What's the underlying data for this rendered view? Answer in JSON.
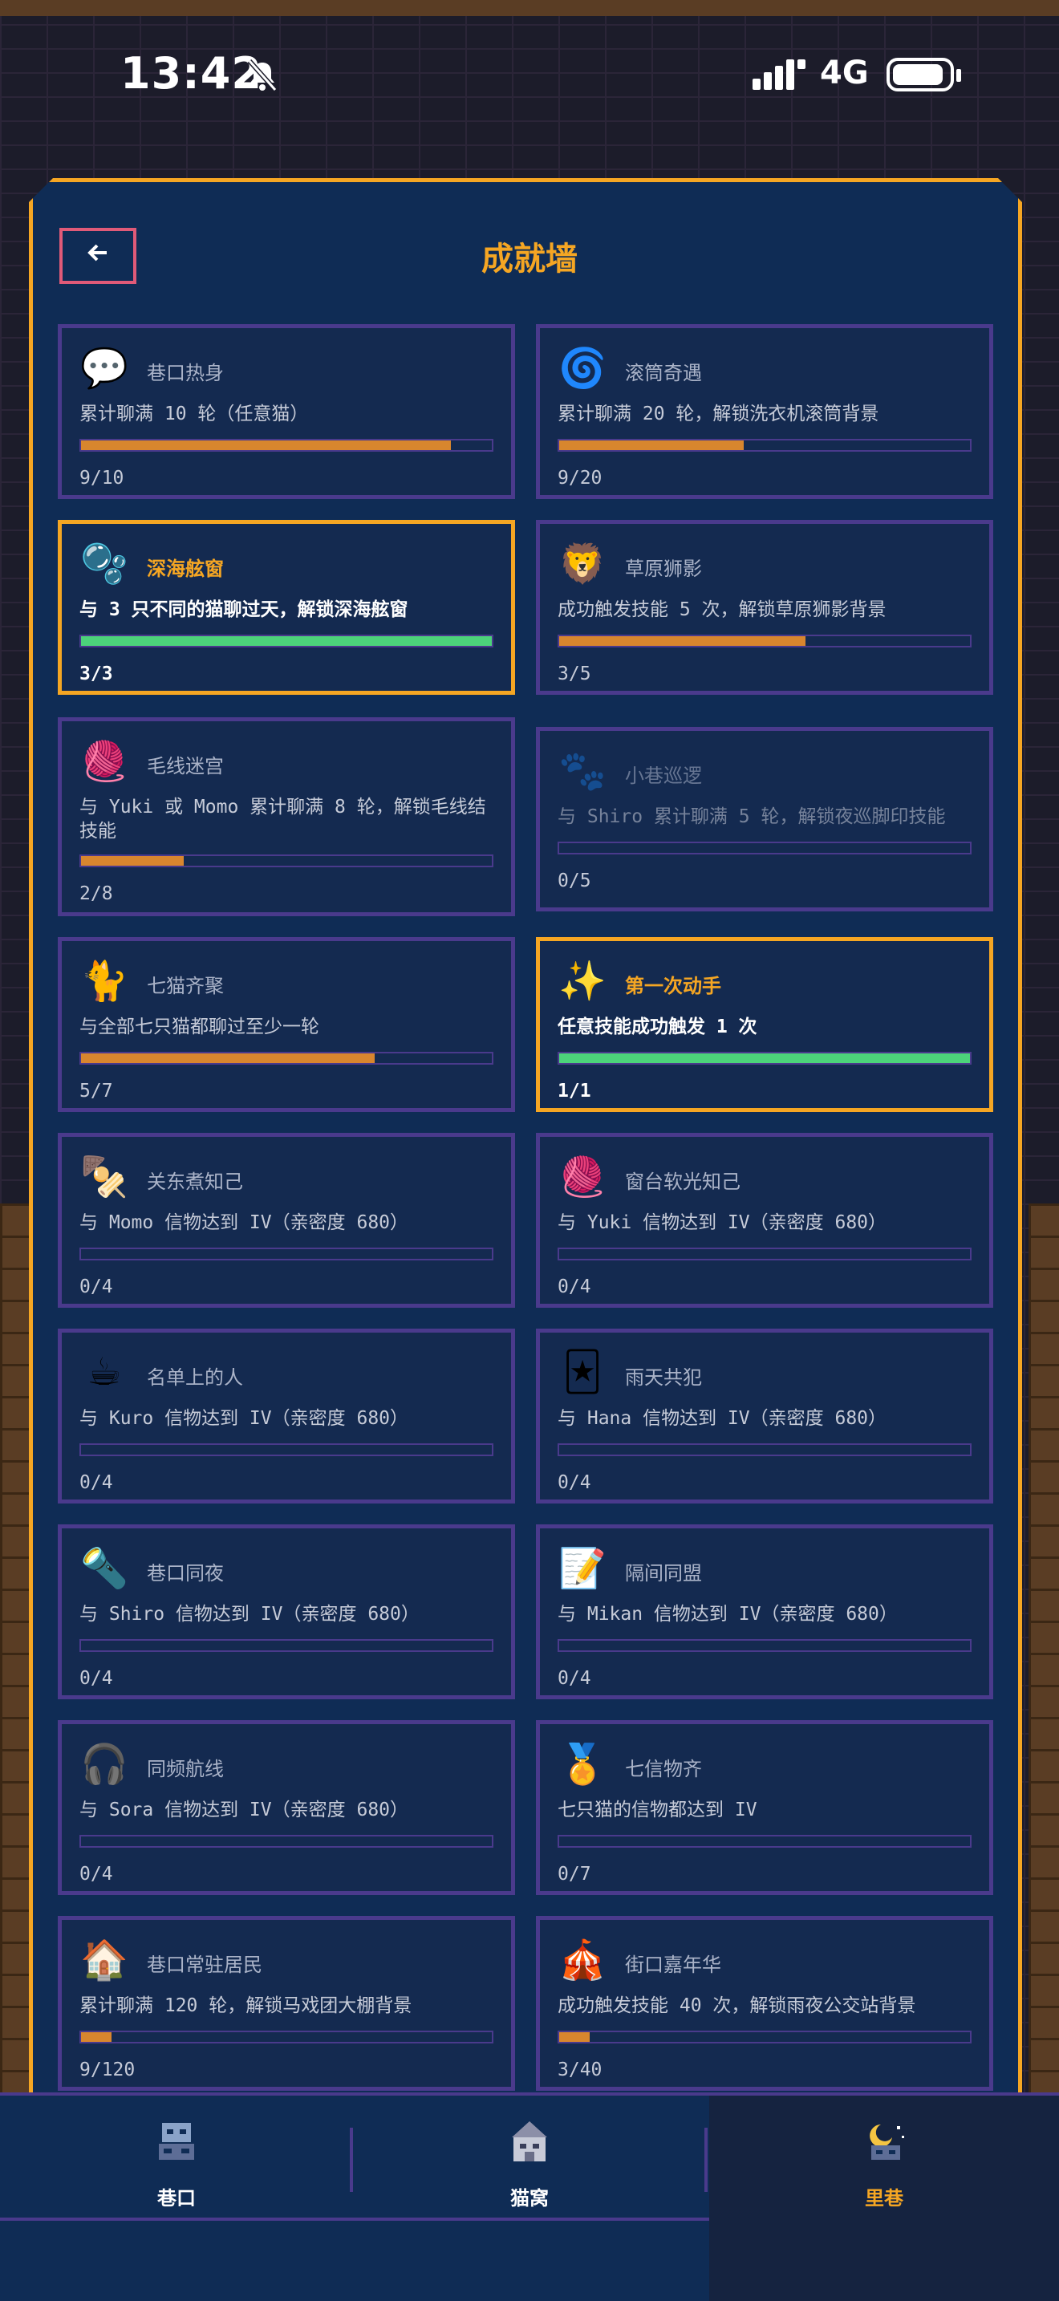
{
  "status": {
    "time": "13:42",
    "network": "4G"
  },
  "header": {
    "title": "成就墙"
  },
  "achievements": [
    {
      "icon": "💬",
      "name": "巷口热身",
      "desc": "累计聊满 10 轮（任意猫）",
      "progress_text": "9/10",
      "progress": 0.9,
      "state": "progress"
    },
    {
      "icon": "🌀",
      "name": "滚筒奇遇",
      "desc": "累计聊满 20 轮，解锁洗衣机滚筒背景",
      "progress_text": "9/20",
      "progress": 0.45,
      "state": "progress"
    },
    {
      "icon": "🫧",
      "name": "深海舷窗",
      "desc": "与 3 只不同的猫聊过天，解锁深海舷窗",
      "progress_text": "3/3",
      "progress": 1.0,
      "state": "done"
    },
    {
      "icon": "🦁",
      "name": "草原狮影",
      "desc": "成功触发技能 5 次，解锁草原狮影背景",
      "progress_text": "3/5",
      "progress": 0.6,
      "state": "progress"
    },
    {
      "icon": "🧶",
      "name": "毛线迷宫",
      "desc": "与 Yuki 或 Momo 累计聊满 8 轮，解锁毛线结技能",
      "progress_text": "2/8",
      "progress": 0.25,
      "state": "progress"
    },
    {
      "icon": "🐾",
      "name": "小巷巡逻",
      "desc": "与 Shiro 累计聊满 5 轮，解锁夜巡脚印技能",
      "progress_text": "0/5",
      "progress": 0.0,
      "state": "locked"
    },
    {
      "icon": "🐈",
      "name": "七猫齐聚",
      "desc": "与全部七只猫都聊过至少一轮",
      "progress_text": "5/7",
      "progress": 0.714,
      "state": "progress"
    },
    {
      "icon": "✨",
      "name": "第一次动手",
      "desc": "任意技能成功触发 1 次",
      "progress_text": "1/1",
      "progress": 1.0,
      "state": "done"
    },
    {
      "icon": "🍢",
      "name": "关东煮知己",
      "desc": "与 Momo 信物达到 IV（亲密度 680）",
      "progress_text": "0/4",
      "progress": 0.0,
      "state": "progress"
    },
    {
      "icon": "🧶",
      "name": "窗台软光知己",
      "desc": "与 Yuki 信物达到 IV（亲密度 680）",
      "progress_text": "0/4",
      "progress": 0.0,
      "state": "progress"
    },
    {
      "icon": "☕",
      "name": "名单上的人",
      "desc": "与 Kuro 信物达到 IV（亲密度 680）",
      "progress_text": "0/4",
      "progress": 0.0,
      "state": "progress"
    },
    {
      "icon": "🃏",
      "name": "雨天共犯",
      "desc": "与 Hana 信物达到 IV（亲密度 680）",
      "progress_text": "0/4",
      "progress": 0.0,
      "state": "progress"
    },
    {
      "icon": "🔦",
      "name": "巷口同夜",
      "desc": "与 Shiro 信物达到 IV（亲密度 680）",
      "progress_text": "0/4",
      "progress": 0.0,
      "state": "progress"
    },
    {
      "icon": "📝",
      "name": "隔间同盟",
      "desc": "与 Mikan 信物达到 IV（亲密度 680）",
      "progress_text": "0/4",
      "progress": 0.0,
      "state": "progress"
    },
    {
      "icon": "🎧",
      "name": "同频航线",
      "desc": "与 Sora 信物达到 IV（亲密度 680）",
      "progress_text": "0/4",
      "progress": 0.0,
      "state": "progress"
    },
    {
      "icon": "🏅",
      "name": "七信物齐",
      "desc": "七只猫的信物都达到 IV",
      "progress_text": "0/7",
      "progress": 0.0,
      "state": "progress"
    },
    {
      "icon": "🏠",
      "name": "巷口常驻居民",
      "desc": "累计聊满 120 轮，解锁马戏团大棚背景",
      "progress_text": "9/120",
      "progress": 0.075,
      "state": "progress"
    },
    {
      "icon": "🎪",
      "name": "街口嘉年华",
      "desc": "成功触发技能 40 次，解锁雨夜公交站背景",
      "progress_text": "3/40",
      "progress": 0.075,
      "state": "progress"
    }
  ],
  "nav": {
    "items": [
      {
        "label": "巷口",
        "active": false
      },
      {
        "label": "猫窝",
        "active": false
      },
      {
        "label": "里巷",
        "active": true
      }
    ]
  },
  "colors": {
    "accent": "#f5a623",
    "panel": "#0f2c55",
    "border": "#4a3a8c",
    "bar_fill": "#d8862e",
    "done_fill": "#4cd37a"
  }
}
